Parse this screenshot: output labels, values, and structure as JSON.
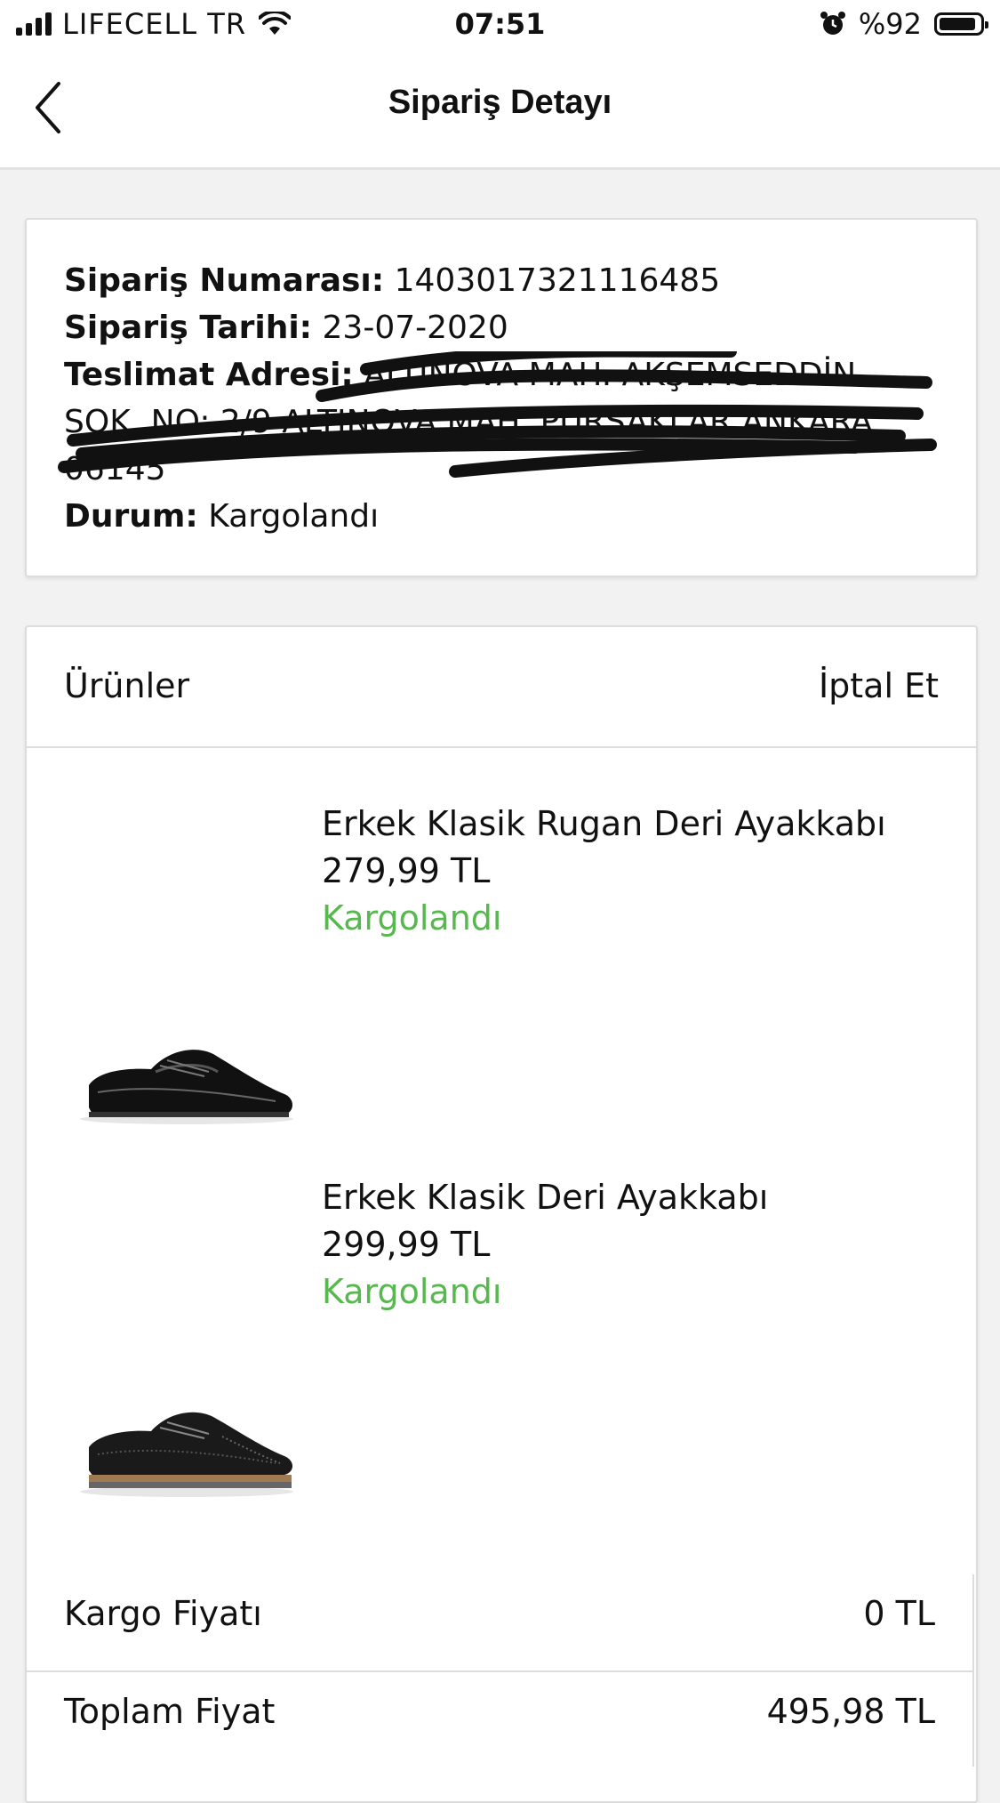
{
  "status_bar": {
    "carrier": "LIFECELL TR",
    "time": "07:51",
    "battery": "%92",
    "battery_level": 0.92,
    "icons": [
      "signal-icon",
      "wifi-icon",
      "alarm-icon",
      "battery-icon"
    ]
  },
  "nav": {
    "title": "Sipariş Detayı",
    "back_icon": "chevron-left-icon"
  },
  "order": {
    "number_label": "Sipariş Numarası:",
    "number_value": "1403017321116485",
    "date_label": "Sipariş Tarihi:",
    "date_value": "23-07-2020",
    "address_label": "Teslimat Adresi:",
    "address_value": "ALTINOVA MAH. AKŞEMSEDDİN SOK. NO: 2/9 ALTINOVA MAH. PURSAKLAR ANKARA 06145",
    "status_label": "Durum:",
    "status_value": "Kargolandı"
  },
  "products": {
    "header": "Ürünler",
    "cancel": "İptal Et",
    "items": [
      {
        "name": "Erkek Klasik Rugan Deri Ayakkabı",
        "price": "279,99 TL",
        "status": "Kargolandı"
      },
      {
        "name": "Erkek Klasik Deri Ayakkabı",
        "price": "299,99 TL",
        "status": "Kargolandı"
      }
    ]
  },
  "summary": {
    "shipping_label": "Kargo Fiyatı",
    "shipping_value": "0 TL",
    "total_label": "Toplam Fiyat",
    "total_value": "495,98 TL"
  },
  "colors": {
    "status_green": "#58b84f",
    "background": "#f2f2f2"
  }
}
